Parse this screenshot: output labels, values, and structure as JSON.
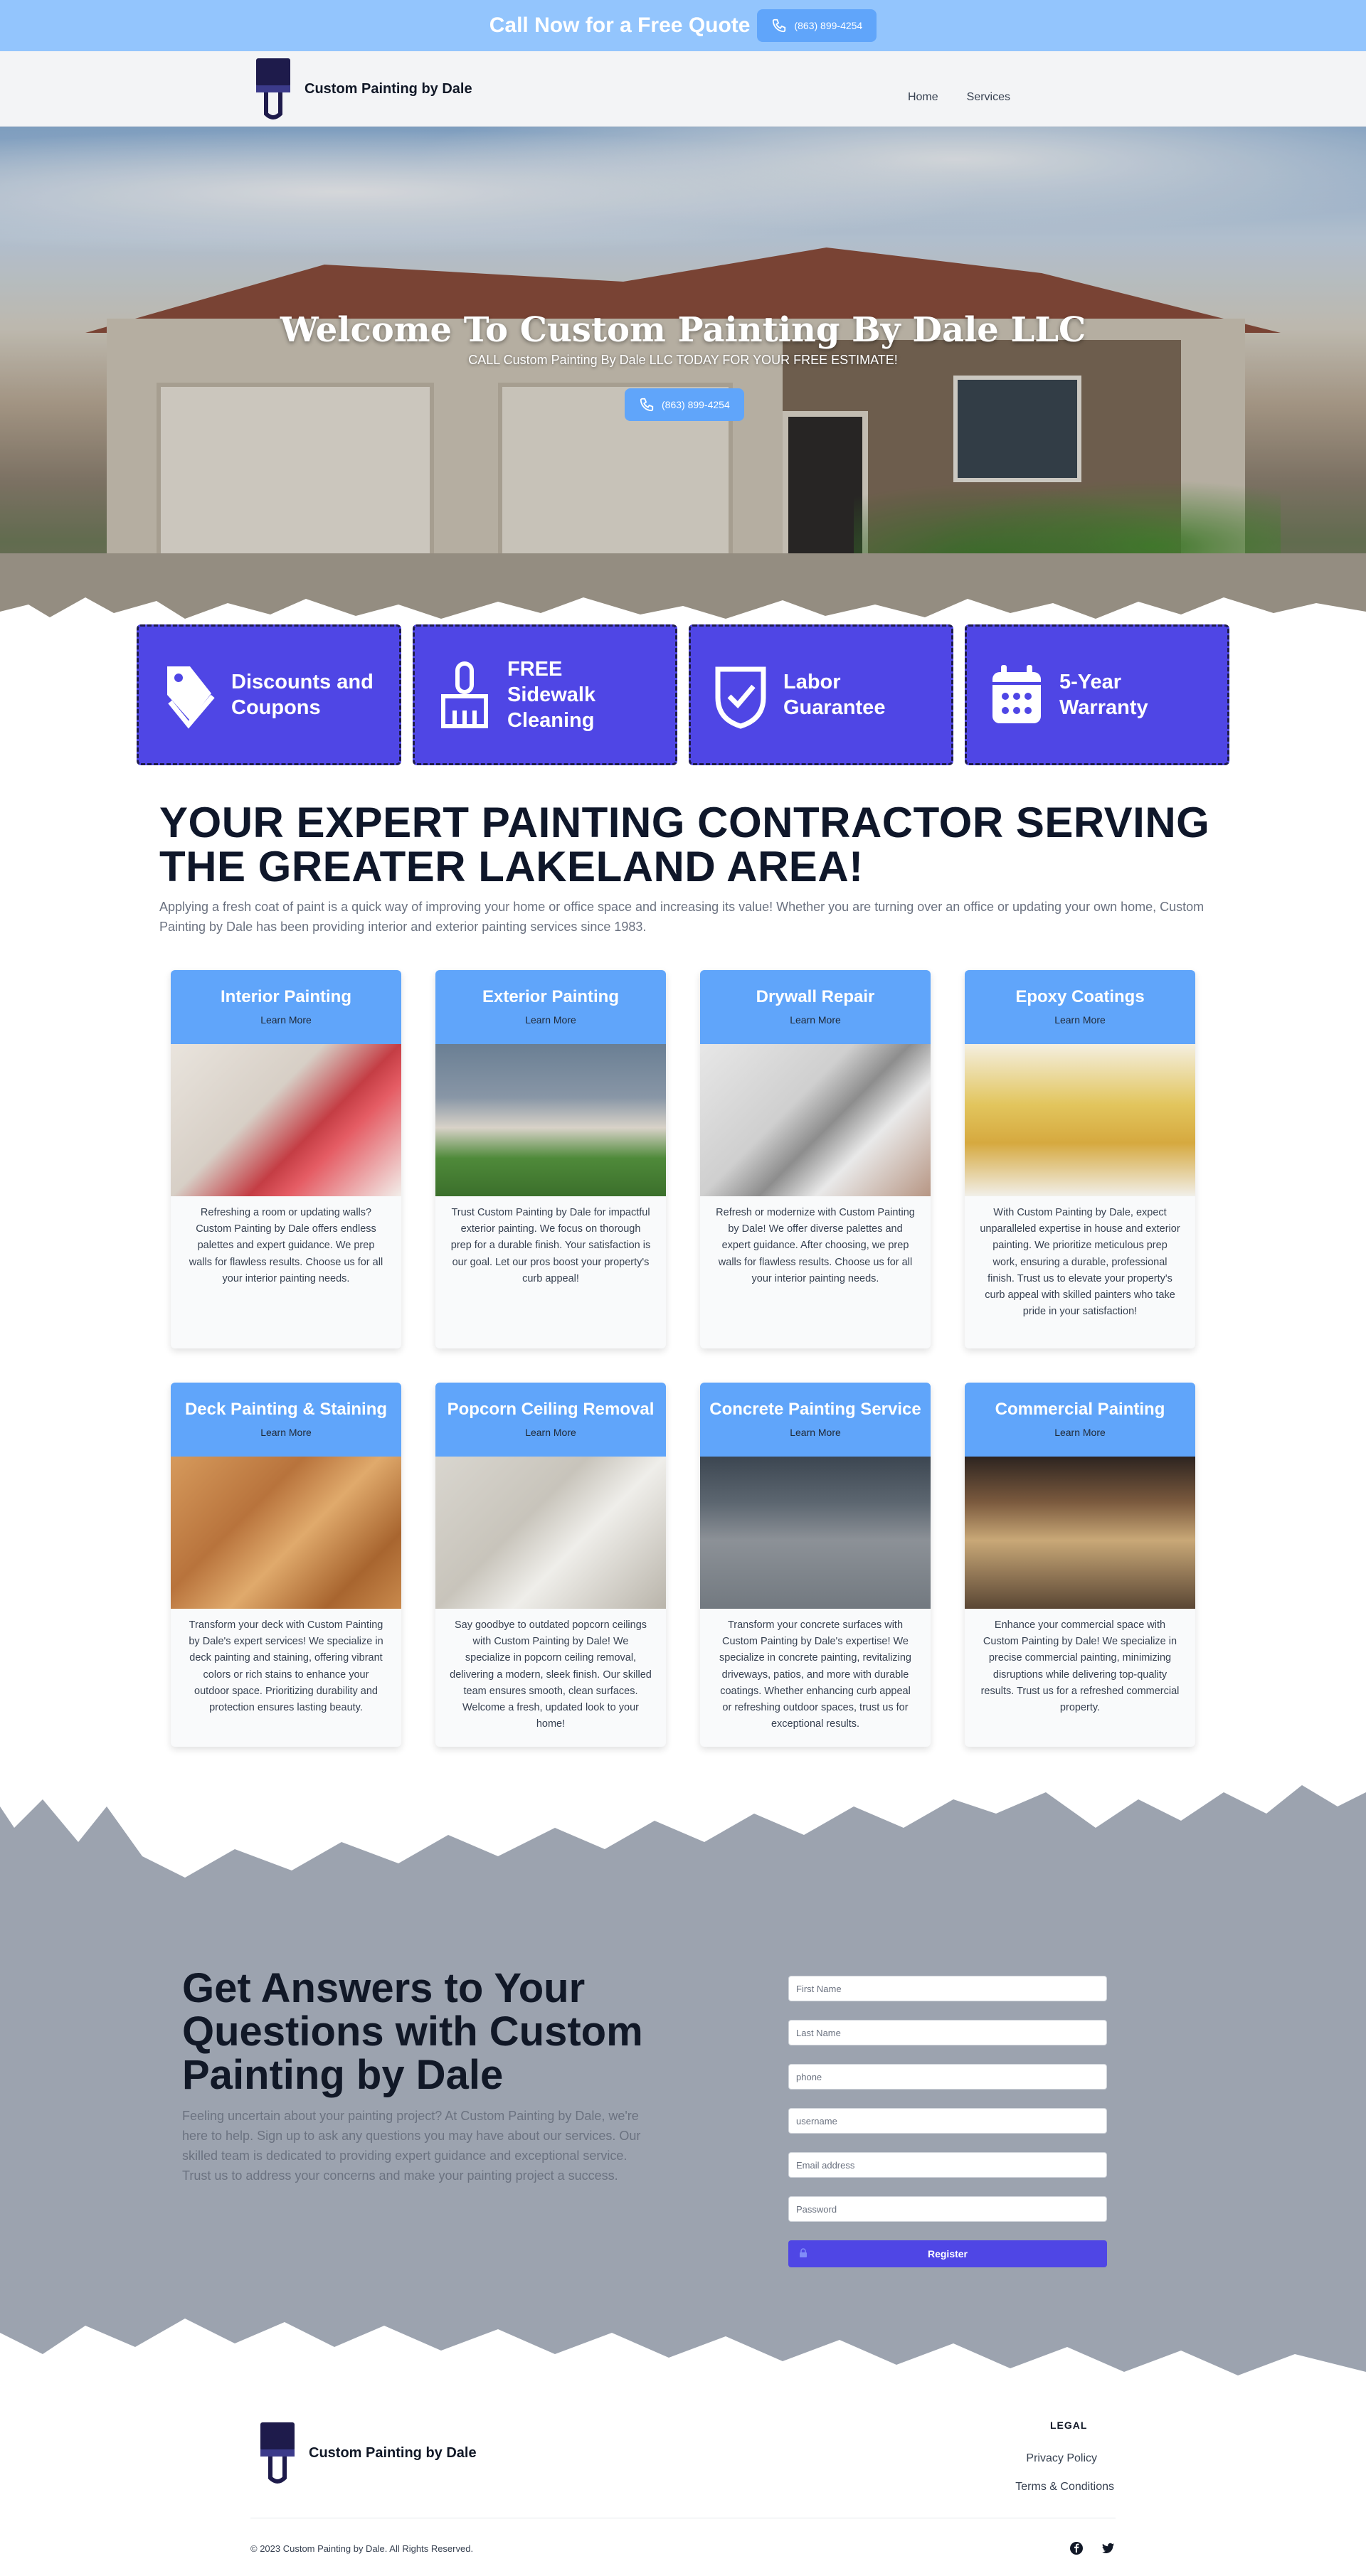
{
  "topbar": {
    "cta": "Call Now for a Free Quote",
    "phone": "(863) 899-4254"
  },
  "brand": {
    "name": "Custom Painting by Dale"
  },
  "nav": {
    "home": "Home",
    "services": "Services"
  },
  "hero": {
    "title": "Welcome To Custom Painting By Dale LLC",
    "subtitle": "CALL Custom Painting By Dale LLC TODAY FOR YOUR FREE ESTIMATE!",
    "phone": "(863) 899-4254"
  },
  "features": [
    {
      "label1": "Discounts and",
      "label2": "Coupons",
      "icon": "tag-icon"
    },
    {
      "label1": "FREE Sidewalk",
      "label2": "Cleaning",
      "icon": "brush-icon"
    },
    {
      "label1": "Labor",
      "label2": "Guarantee",
      "icon": "shield-check-icon"
    },
    {
      "label1": "5-Year",
      "label2": "Warranty",
      "icon": "calendar-icon"
    }
  ],
  "intro": {
    "heading": "YOUR EXPERT PAINTING CONTRACTOR SERVING THE GREATER LAKELAND AREA!",
    "text": "Applying a fresh coat of paint is a quick way of improving your home or office space and increasing its value! Whether you are turning over an office or updating your own home, Custom Painting by Dale has been providing interior and exterior painting services since 1983."
  },
  "services": [
    {
      "title": "Interior Painting",
      "link": "Learn More",
      "desc": "Refreshing a room or updating walls? Custom Painting by Dale offers endless palettes and expert guidance. We prep walls for flawless results. Choose us for all your interior painting needs."
    },
    {
      "title": "Exterior Painting",
      "link": "Learn More",
      "desc": "Trust Custom Painting by Dale for impactful exterior painting. We focus on thorough prep for a durable finish. Your satisfaction is our goal. Let our pros boost your property's curb appeal!"
    },
    {
      "title": "Drywall Repair",
      "link": "Learn More",
      "desc": "Refresh or modernize with Custom Painting by Dale! We offer diverse palettes and expert guidance. After choosing, we prep walls for flawless results. Choose us for all your interior painting needs."
    },
    {
      "title": "Epoxy Coatings",
      "link": "Learn More",
      "desc": "With Custom Painting by Dale, expect unparalleled expertise in house and exterior painting. We prioritize meticulous prep work, ensuring a durable, professional finish. Trust us to elevate your property's curb appeal with skilled painters who take pride in your satisfaction!"
    },
    {
      "title": "Deck Painting & Staining",
      "link": "Learn More",
      "desc": "Transform your deck with Custom Painting by Dale's expert services! We specialize in deck painting and staining, offering vibrant colors or rich stains to enhance your outdoor space. Prioritizing durability and protection ensures lasting beauty."
    },
    {
      "title": "Popcorn Ceiling Removal",
      "link": "Learn More",
      "desc": "Say goodbye to outdated popcorn ceilings with Custom Painting by Dale! We specialize in popcorn ceiling removal, delivering a modern, sleek finish. Our skilled team ensures smooth, clean surfaces. Welcome a fresh, updated look to your home!"
    },
    {
      "title": "Concrete Painting Service",
      "link": "Learn More",
      "desc": "Transform your concrete surfaces with Custom Painting by Dale's expertise! We specialize in concrete painting, revitalizing driveways, patios, and more with durable coatings. Whether enhancing curb appeal or refreshing outdoor spaces, trust us for exceptional results."
    },
    {
      "title": "Commercial Painting",
      "link": "Learn More",
      "desc": "Enhance your commercial space with Custom Painting by Dale! We specialize in precise commercial painting, minimizing disruptions while delivering top-quality results. Trust us for a refreshed commercial property."
    }
  ],
  "contact": {
    "heading": "Get Answers to Your Questions with Custom Painting by Dale",
    "text": "Feeling uncertain about your painting project? At Custom Painting by Dale, we're here to help. Sign up to ask any questions you may have about our services. Our skilled team is dedicated to providing expert guidance and exceptional service. Trust us to address your concerns and make your painting project a success.",
    "fields": {
      "first_name": "First Name",
      "last_name": "Last Name",
      "phone": "phone",
      "username": "username",
      "email": "Email address",
      "password": "Password"
    },
    "register": "Register"
  },
  "footer": {
    "brand": "Custom Painting by Dale",
    "legal": "LEGAL",
    "privacy": "Privacy Policy",
    "terms": "Terms & Conditions",
    "copyright": "© 2023 Custom Painting by Dale. All Rights Reserved."
  },
  "colors": {
    "topbar": "#93c5fd",
    "accent_blue": "#60a5fa",
    "indigo": "#4f46e5",
    "contact_bg": "#9ca3af"
  }
}
